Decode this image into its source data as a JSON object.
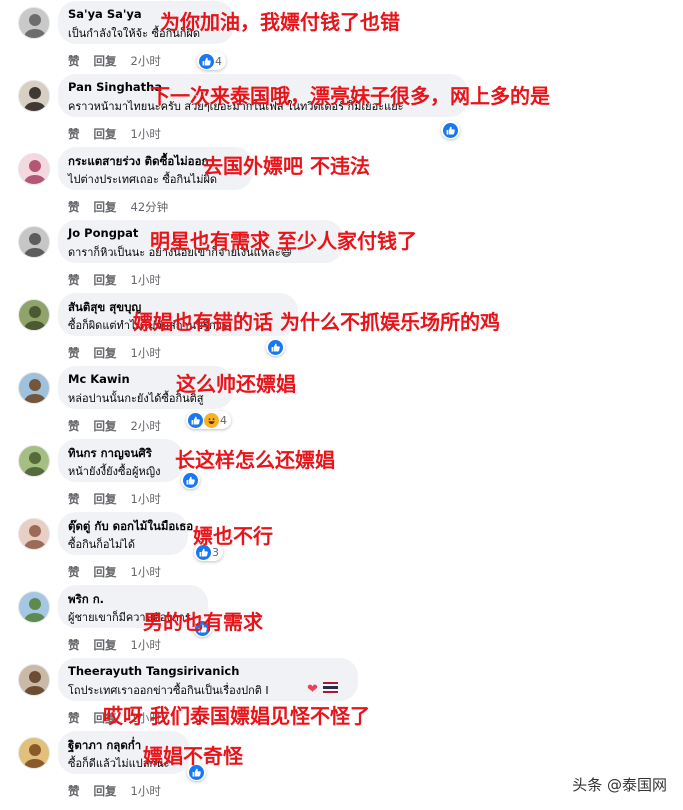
{
  "actions": {
    "like": "赞",
    "reply": "回复"
  },
  "comments": [
    {
      "author": "Sa'ya Sa'ya",
      "text": "เป็นกำลังใจให้จ้ะ ซื้อกินก็ผิด",
      "time": "2小时",
      "overlay": "为你加油，我嫖付钱了也错",
      "reactions": {
        "like": true,
        "count": "4"
      }
    },
    {
      "author": "Pan Singhatha",
      "text": "คราวหน้ามาไทยนะครับ สวยๆเยอะมากในเฟส ในทวิตเตอร์ ก็มีเยอะแยะ",
      "time": "1小时",
      "overlay": "下一次来泰国哦，漂亮妹子很多，网上多的是",
      "reactions": {
        "like": true,
        "count": ""
      }
    },
    {
      "author": "กระแตสายร่วง ติดซื้อไม่ออก",
      "text": "ไปต่างประเทศเถอะ ซื้อกินไม่ผิด",
      "time": "42分钟",
      "overlay": "去国外嫖吧 不违法",
      "reactions": null
    },
    {
      "author": "Jo Pongpat",
      "text": "ดาราก็หิวเป็นนะ อย่างน้อยเขาก็จ่ายเงินแหละ😄",
      "time": "1小时",
      "overlay": "明星也有需求 至少人家付钱了",
      "reactions": null
    },
    {
      "author": "สันติสุข สุขบุญ",
      "text": "ซื้อก็ผิดแต่ทำไมไม่จับสถานบริการ",
      "time": "1小时",
      "overlay": "嫖娼也有错的话 为什么不抓娱乐场所的鸡",
      "reactions": {
        "like": true,
        "count": ""
      }
    },
    {
      "author": "Mc Kawin",
      "text": "หล่อปานนั้นกะยังได้ซื้อกินติสู",
      "time": "2小时",
      "overlay": "这么帅还嫖娼",
      "reactions": {
        "like": true,
        "haha": true,
        "count": "4"
      }
    },
    {
      "author": "ทินกร กาญจนศิริ",
      "text": "หน้ายังงี้ยังซื้อผู้หญิง",
      "time": "1小时",
      "overlay": "长这样怎么还嫖娼",
      "reactions": {
        "like": true,
        "count": ""
      }
    },
    {
      "author": "ตุ๊ดตู่ กับ ดอกไม้ในมือเธอ",
      "text": "ซื้อกินก็อไม่ได้",
      "time": "1小时",
      "overlay": "嫖也不行",
      "reactions": {
        "like": true,
        "count": "3"
      }
    },
    {
      "author": "พริก ก.",
      "text": "ผู้ชายเขาก็มีความต้องการ",
      "time": "1小时",
      "overlay": "男的也有需求",
      "reactions": {
        "like": true,
        "count": ""
      }
    },
    {
      "author": "Theerayuth Tangsirivanich",
      "text": "โถประเทศเราออกข่าวซื้อกินเป็นเรื่องปกติ I",
      "time": "1小时",
      "overlay": "哎呀 我们泰国嫖娼见怪不怪了",
      "reactions": null,
      "trailing": {
        "heart": "❤",
        "flag": "thai-flag"
      }
    },
    {
      "author": "ฐิตาภา กลุดก่ำ",
      "text": "ซื้อก็ดีแล้วไม่แปลกนะ",
      "time": "1小时",
      "overlay": "嫖娼不奇怪",
      "reactions": {
        "like": true,
        "count": ""
      }
    }
  ],
  "watermark": "头条 @泰国网",
  "colors": {
    "overlay": "#e8141a",
    "like_blue": "#1877f2",
    "bubble": "#f0f2f5",
    "meta_gray": "#65676b"
  }
}
